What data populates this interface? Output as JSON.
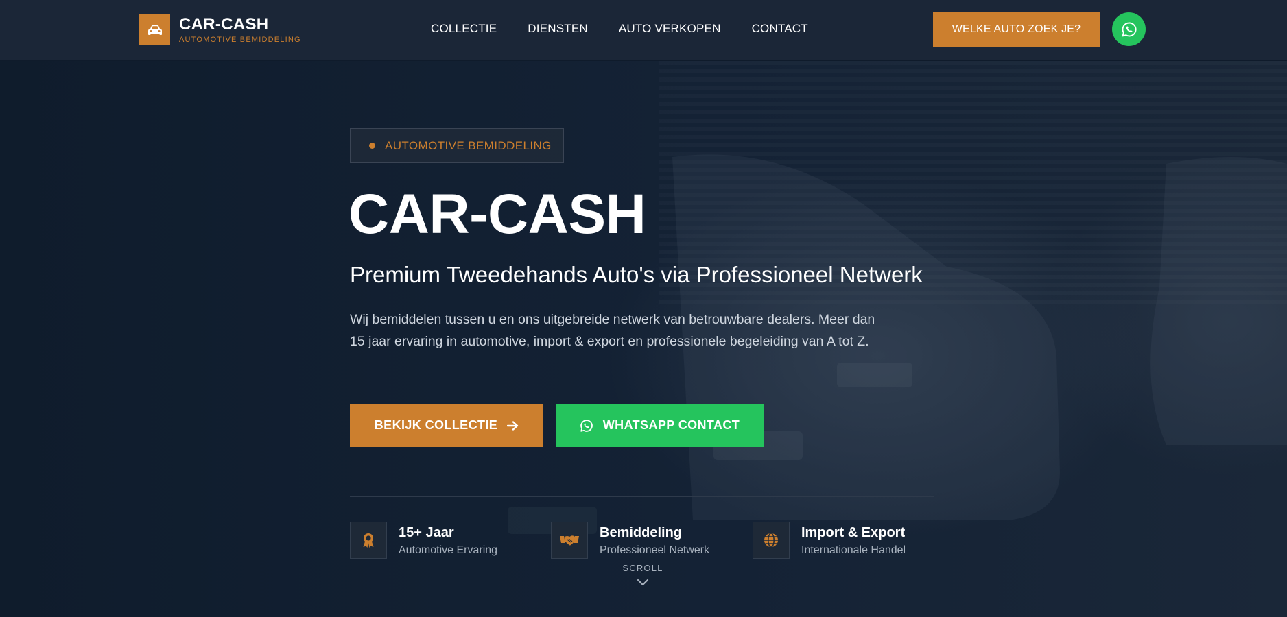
{
  "header": {
    "brand_name": "CAR-CASH",
    "brand_tagline": "AUTOMOTIVE BEMIDDELING",
    "nav": [
      "COLLECTIE",
      "DIENSTEN",
      "AUTO VERKOPEN",
      "CONTACT"
    ],
    "cta_label": "WELKE AUTO ZOEK JE?",
    "whatsapp_icon": "whatsapp-icon"
  },
  "hero": {
    "badge": "AUTOMOTIVE BEMIDDELING",
    "title": "CAR-CASH",
    "subtitle": "Premium Tweedehands Auto's via Professioneel Netwerk",
    "description": "Wij bemiddelen tussen u en ons uitgebreide netwerk van betrouwbare dealers. Meer dan 15 jaar ervaring in automotive, import & export en professionele begeleiding van A tot Z.",
    "primary_button": "BEKIJK COLLECTIE",
    "whatsapp_button": "WHATSAPP CONTACT",
    "background_image": "dark photo of parked cars"
  },
  "features": [
    {
      "title": "15+ Jaar",
      "subtitle": "Automotive Ervaring",
      "icon": "award-icon"
    },
    {
      "title": "Bemiddeling",
      "subtitle": "Professioneel Netwerk",
      "icon": "handshake-icon"
    },
    {
      "title": "Import & Export",
      "subtitle": "Internationale Handel",
      "icon": "globe-icon"
    }
  ],
  "scroll_label": "SCROLL",
  "colors": {
    "accent": "#cc7f2e",
    "whatsapp": "#25c45d",
    "header_bg": "#1b2637",
    "hero_bg": "#0f1b2b"
  }
}
